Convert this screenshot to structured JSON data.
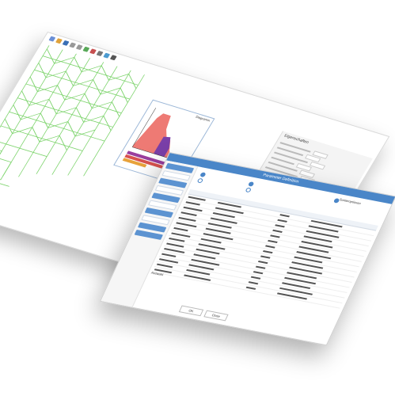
{
  "chart_window": {
    "title": "Diagramm"
  },
  "property_panel": {
    "title": "Eigenschaften"
  },
  "dialog": {
    "title": "Parameter Definition",
    "ok_label": "OK",
    "cancel_label": "Close",
    "selection_label": "Auswahl",
    "sort_label": "Sortieroptionen"
  },
  "colors": {
    "accent": "#4a86c8",
    "cad_green": "#7bd36a",
    "chart_fill": "#ee7a74",
    "chart_purple": "#7a3fa8"
  }
}
